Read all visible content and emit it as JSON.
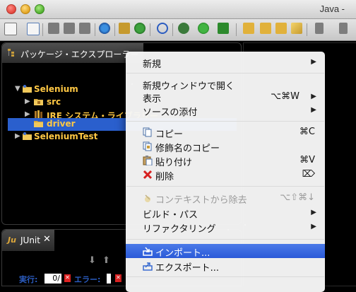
{
  "window": {
    "title": "Java -"
  },
  "toolbar": {
    "icons": [
      "new-icon",
      "new-java-project-icon",
      "save-icon",
      "save-all-icon",
      "print-icon",
      "build-icon",
      "new-package-icon",
      "refresh-icon",
      "skip-breakpoints-icon",
      "debug-icon",
      "run-icon",
      "run-external-icon",
      "open-type-icon",
      "open-folder-icon",
      "open-folder-2-icon",
      "brush-icon",
      "nav-back-icon",
      "nav-forward-icon"
    ]
  },
  "package_explorer": {
    "tab_label": "パッケージ・エクスプローラー",
    "tree": [
      {
        "label": "Selenium",
        "expanded": true
      },
      {
        "label": "src"
      },
      {
        "label": "JRE システム・ライブラリー"
      },
      {
        "label": "driver",
        "selected": true
      },
      {
        "label": "SeleniumTest",
        "expanded": false
      }
    ]
  },
  "junit": {
    "tab_label": "JUnit",
    "runs_label": "実行:",
    "runs_value": "0/",
    "errors_label": "エラー:"
  },
  "context_menu": {
    "items": [
      {
        "label": "新規",
        "submenu": true
      },
      {
        "label": "新規ウィンドウで開く"
      },
      {
        "label": "表示",
        "shortcut": "⌥⌘W",
        "submenu": true
      },
      {
        "label": "ソースの添付",
        "submenu": true
      },
      {
        "label": "コピー",
        "shortcut": "⌘C",
        "icon": "copy-icon"
      },
      {
        "label": "修飾名のコピー",
        "icon": "copy-qualified-icon"
      },
      {
        "label": "貼り付け",
        "shortcut": "⌘V",
        "icon": "paste-icon"
      },
      {
        "label": "削除",
        "shortcut": "⌦",
        "icon": "delete-icon"
      },
      {
        "label": "コンテキストから除去",
        "shortcut": "⌥⇧⌘↓",
        "disabled": true,
        "icon": "remove-context-icon"
      },
      {
        "label": "ビルド・パス",
        "submenu": true
      },
      {
        "label": "リファクタリング",
        "submenu": true
      },
      {
        "label": "インポート...",
        "highlighted": true,
        "icon": "import-icon"
      },
      {
        "label": "エクスポート...",
        "icon": "export-icon"
      }
    ]
  },
  "colors": {
    "selection": "#2a5fcd",
    "menu_highlight": "#3563db",
    "tree_text": "#ffc844"
  }
}
